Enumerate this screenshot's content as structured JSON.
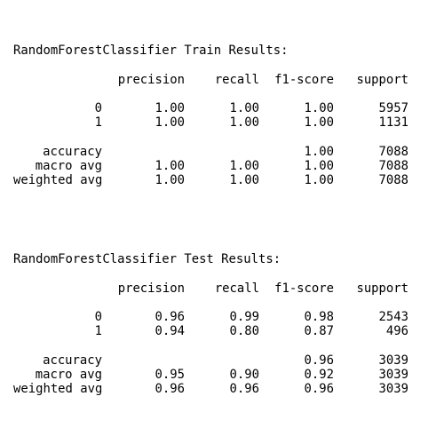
{
  "train": {
    "title": "RandomForestClassifier Train Results:",
    "headers": [
      "precision",
      "recall",
      "f1-score",
      "support"
    ],
    "classes": [
      {
        "label": "0",
        "precision": "1.00",
        "recall": "1.00",
        "f1": "1.00",
        "support": "5957"
      },
      {
        "label": "1",
        "precision": "1.00",
        "recall": "1.00",
        "f1": "1.00",
        "support": "1131"
      }
    ],
    "accuracy": {
      "label": "accuracy",
      "f1": "1.00",
      "support": "7088"
    },
    "macro": {
      "label": "macro avg",
      "precision": "1.00",
      "recall": "1.00",
      "f1": "1.00",
      "support": "7088"
    },
    "weighted": {
      "label": "weighted avg",
      "precision": "1.00",
      "recall": "1.00",
      "f1": "1.00",
      "support": "7088"
    }
  },
  "test": {
    "title": "RandomForestClassifier Test Results:",
    "headers": [
      "precision",
      "recall",
      "f1-score",
      "support"
    ],
    "classes": [
      {
        "label": "0",
        "precision": "0.96",
        "recall": "0.99",
        "f1": "0.98",
        "support": "2543"
      },
      {
        "label": "1",
        "precision": "0.94",
        "recall": "0.80",
        "f1": "0.87",
        "support": "496"
      }
    ],
    "accuracy": {
      "label": "accuracy",
      "f1": "0.96",
      "support": "3039"
    },
    "macro": {
      "label": "macro avg",
      "precision": "0.95",
      "recall": "0.90",
      "f1": "0.92",
      "support": "3039"
    },
    "weighted": {
      "label": "weighted avg",
      "precision": "0.96",
      "recall": "0.96",
      "f1": "0.96",
      "support": "3039"
    }
  }
}
